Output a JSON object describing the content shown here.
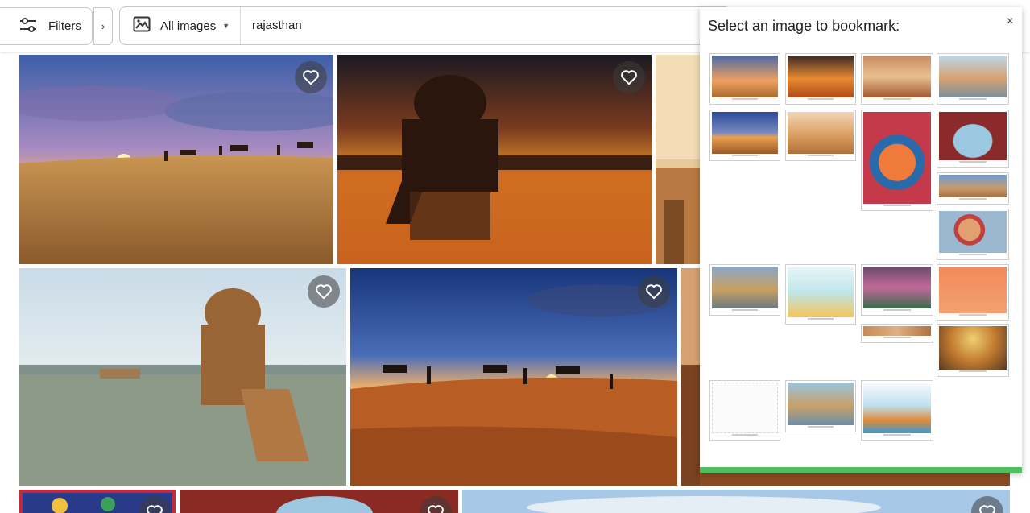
{
  "toolbar": {
    "filters_label": "Filters",
    "expand_glyph": "›",
    "image_type_label": "All images",
    "search_query": "rajasthan"
  },
  "popup": {
    "title": "Select an image to bookmark:",
    "close_glyph": "×"
  },
  "icons": {
    "filters": "sliders-icon",
    "image_type": "image-icon",
    "favorite": "heart-outline-icon"
  },
  "colors": {
    "popup_accent_bar": "#4fbf5d",
    "badge": "#d93025"
  },
  "results": [
    {
      "id": "camels-sunset-dunes"
    },
    {
      "id": "gadisar-chhatri-sunset"
    },
    {
      "id": "fort-wall-partial"
    },
    {
      "id": "gadisar-chhatri-day"
    },
    {
      "id": "camel-caravan-dusk"
    },
    {
      "id": "haveli-partial"
    },
    {
      "id": "colorful-art-partial"
    },
    {
      "id": "palace-arch-partial"
    },
    {
      "id": "lake-panorama-partial"
    }
  ],
  "bookmark_thumbnails": [
    {
      "id": "t1"
    },
    {
      "id": "t2"
    },
    {
      "id": "t3"
    },
    {
      "id": "t4"
    },
    {
      "id": "t5"
    },
    {
      "id": "t6"
    },
    {
      "id": "t7"
    },
    {
      "id": "t8"
    },
    {
      "id": "t9"
    },
    {
      "id": "t10"
    },
    {
      "id": "t11"
    },
    {
      "id": "t12"
    },
    {
      "id": "t13"
    },
    {
      "id": "t14"
    },
    {
      "id": "t15"
    },
    {
      "id": "t16"
    },
    {
      "id": "t17"
    },
    {
      "id": "t18"
    },
    {
      "id": "t19"
    },
    {
      "id": "t20"
    }
  ]
}
